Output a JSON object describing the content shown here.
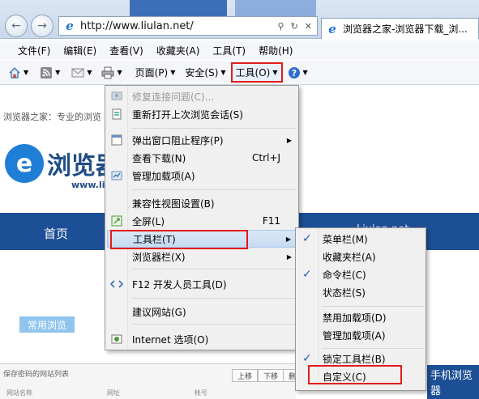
{
  "browser": {
    "address_url": "http://www.liulan.net/",
    "tab_title": "浏览器之家-浏览器下载_浏...",
    "back_icon": "back-arrow-icon",
    "forward_icon": "forward-arrow-icon"
  },
  "menubar": {
    "items": [
      "文件(F)",
      "编辑(E)",
      "查看(V)",
      "收藏夹(A)",
      "工具(T)",
      "帮助(H)"
    ]
  },
  "commandbar": {
    "page_label": "页面(P)",
    "safety_label": "安全(S)",
    "tools_label": "工具(O)"
  },
  "page": {
    "breadcrumb": "浏览器之家：专业的浏览",
    "logo_name": "浏览器",
    "logo_url": "www.liul",
    "nav_home": "首页",
    "nav_right": "Liulan.net",
    "common_tag": "常用浏览",
    "fav_title": "保存密码的网站列表",
    "fav_up": "上移",
    "fav_down": "下移",
    "fav_del": "删除",
    "col_name": "网站名称",
    "col_url": "网址",
    "col_account": "帐号",
    "app_banner": "手机浏览器"
  },
  "tools_menu": {
    "items": [
      {
        "label": "修复连接问题(C)...",
        "accel": "",
        "sub": false,
        "disabled": true
      },
      {
        "label": "重新打开上次浏览会话(S)",
        "accel": "",
        "sub": false,
        "disabled": false
      },
      {
        "label": "弹出窗口阻止程序(P)",
        "accel": "",
        "sub": true,
        "disabled": false
      },
      {
        "label": "查看下载(N)",
        "accel": "Ctrl+J",
        "sub": false,
        "disabled": false
      },
      {
        "label": "管理加载项(A)",
        "accel": "",
        "sub": false,
        "disabled": false
      },
      {
        "label": "兼容性视图设置(B)",
        "accel": "",
        "sub": false,
        "disabled": false
      },
      {
        "label": "全屏(L)",
        "accel": "F11",
        "sub": false,
        "disabled": false
      },
      {
        "label": "工具栏(T)",
        "accel": "",
        "sub": true,
        "disabled": false
      },
      {
        "label": "浏览器栏(X)",
        "accel": "",
        "sub": true,
        "disabled": false
      },
      {
        "label": "F12 开发人员工具(D)",
        "accel": "",
        "sub": false,
        "disabled": false
      },
      {
        "label": "建议网站(G)",
        "accel": "",
        "sub": false,
        "disabled": false
      },
      {
        "label": "Internet 选项(O)",
        "accel": "",
        "sub": false,
        "disabled": false
      }
    ]
  },
  "toolbar_submenu": {
    "items": [
      {
        "label": "菜单栏(M)",
        "checked": true
      },
      {
        "label": "收藏夹栏(A)",
        "checked": false
      },
      {
        "label": "命令栏(C)",
        "checked": true
      },
      {
        "label": "状态栏(S)",
        "checked": false
      },
      {
        "label": "禁用加载项(D)",
        "checked": false
      },
      {
        "label": "管理加载项(A)",
        "checked": false
      },
      {
        "label": "锁定工具栏(B)",
        "checked": true
      },
      {
        "label": "自定义(C)",
        "checked": false
      }
    ]
  },
  "colors": {
    "highlight_box": "#e21b1b",
    "nav_blue": "#1c4f95",
    "accent": "#1f7ed6"
  }
}
